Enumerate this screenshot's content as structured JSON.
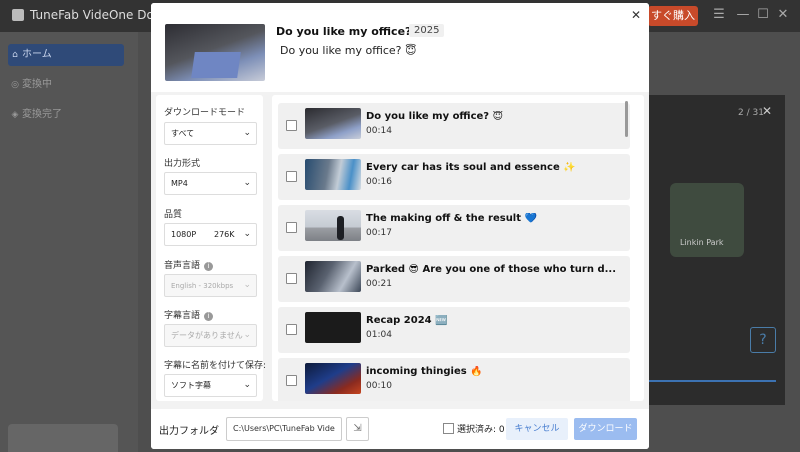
{
  "app": {
    "title": "TuneFab VideOne Downlo",
    "buy_label": "すぐ購入",
    "sidebar": [
      {
        "label": "ホーム",
        "active": true
      },
      {
        "label": "変換中",
        "active": false
      },
      {
        "label": "変換完了",
        "active": false
      }
    ],
    "right_panel": {
      "count": "2 / 31",
      "thumb_label": "Linkin Park"
    }
  },
  "dialog": {
    "header": {
      "title": "Do you like my office? 😇",
      "year": "2025",
      "subtitle": "Do you like my office? 😇"
    },
    "settings": {
      "download_mode_label": "ダウンロードモード",
      "download_mode_value": "すべて",
      "format_label": "出力形式",
      "format_value": "MP4",
      "quality_label": "品質",
      "quality_value": "1080P       276K",
      "audio_lang_label": "音声言語",
      "audio_lang_value": "English - 320kbps",
      "subtitle_lang_label": "字幕言語",
      "subtitle_lang_value": "データがありません",
      "subtitle_save_label": "字幕に名前を付けて保存:",
      "subtitle_save_value": "ソフト字幕"
    },
    "items": [
      {
        "title": "Do you like my office? 😇",
        "duration": "00:14"
      },
      {
        "title": "Every car has its soul and essence ✨",
        "duration": "00:16"
      },
      {
        "title": "The making off & the result 💙",
        "duration": "00:17"
      },
      {
        "title": "Parked 😎 Are you one of those who turn d...",
        "duration": "00:21"
      },
      {
        "title": "Recap 2024 🆕",
        "duration": "01:04"
      },
      {
        "title": "incoming thingies 🔥",
        "duration": "00:10"
      }
    ],
    "footer": {
      "folder_label": "出力フォルダ",
      "folder_path": "C:\\Users\\PC\\TuneFab Vide",
      "selected_label": "選択済み: 0",
      "cancel_label": "キャンセル",
      "download_label": "ダウンロード"
    }
  }
}
